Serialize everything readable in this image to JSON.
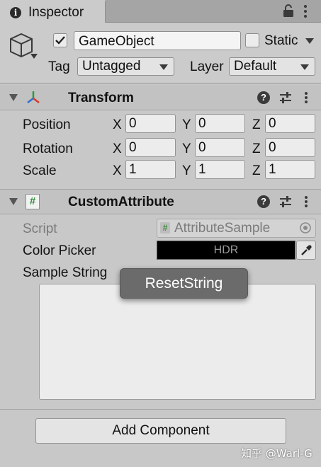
{
  "tab": {
    "title": "Inspector",
    "icon": "info-icon"
  },
  "gameobject": {
    "name": "GameObject",
    "active": true,
    "static_label": "Static",
    "static_checked": false,
    "tag_label": "Tag",
    "tag_value": "Untagged",
    "layer_label": "Layer",
    "layer_value": "Default"
  },
  "transform": {
    "title": "Transform",
    "rows": [
      {
        "label": "Position",
        "x": "0",
        "y": "0",
        "z": "0"
      },
      {
        "label": "Rotation",
        "x": "0",
        "y": "0",
        "z": "0"
      },
      {
        "label": "Scale",
        "x": "1",
        "y": "1",
        "z": "1"
      }
    ],
    "axis_x": "X",
    "axis_y": "Y",
    "axis_z": "Z"
  },
  "custom": {
    "title": "CustomAttribute",
    "script_label": "Script",
    "script_value": "AttributeSample",
    "color_label": "Color Picker",
    "color_hdr": "HDR",
    "color_value": "#000000",
    "string_label": "Sample String",
    "tooltip": "ResetString"
  },
  "footer": {
    "add_component": "Add Component",
    "watermark": "知乎 @Warl-G"
  },
  "colors": {
    "panel": "#c8c8c8",
    "header": "#c2c2c2",
    "tooltip": "#6b6b6b"
  }
}
